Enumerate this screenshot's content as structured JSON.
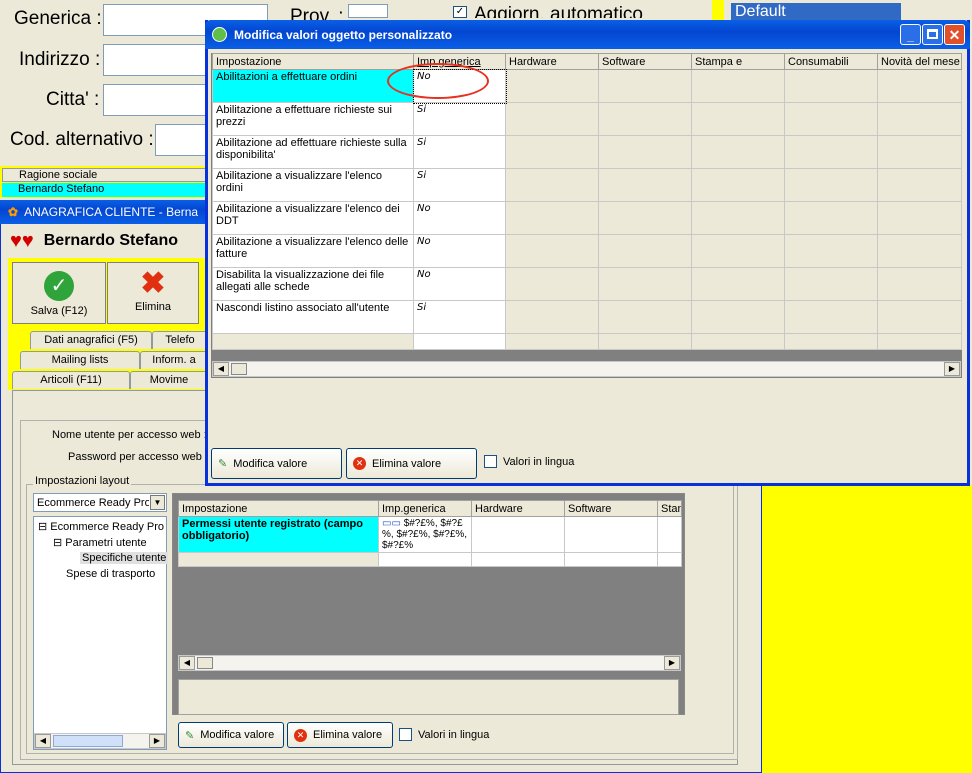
{
  "bg_form": {
    "generica_label": "Generica :",
    "indirizzo_label": "Indirizzo :",
    "citta_label": "Citta' :",
    "cod_label": "Cod. alternativo :",
    "prov_label": "Prov. :",
    "aggiorn_label": "Aggiorn. automatico",
    "default_label": "Default"
  },
  "bg_list": {
    "header": "Ragione sociale",
    "row1": "Bernardo Stefano"
  },
  "cliente": {
    "title": "ANAGRAFICA CLIENTE - Berna",
    "name": "Bernardo Stefano",
    "save_label": "Salva (F12)",
    "delete_label": "Elimina",
    "tabs": {
      "t1": "Dati anagrafici (F5)",
      "t2": "Telefo",
      "t3": "Mailing lists",
      "t4": "Inform. a",
      "t5": "Articoli (F11)",
      "t6": "Movime"
    },
    "web_user_label": "Nome utente per accesso web :",
    "web_pass_label": "Password per accesso web :",
    "layout_group": "Impostazioni layout",
    "layout_select": "Ecommerce Ready Pro",
    "tree": {
      "root": "Ecommerce Ready Pro",
      "child": "Parametri utente",
      "leaf": "Specifiche utente",
      "other": "Spese di trasporto"
    },
    "grid": {
      "headers": [
        "Impostazione",
        "Imp.generica",
        "Hardware",
        "Software",
        "Stan"
      ],
      "row_label": "Permessi utente registrato (campo obbligatorio)",
      "row_value": "$#?£%, $#?£%, $#?£%, $#?£%, $#?£%"
    },
    "modify_label": "Modifica valore",
    "delete_value_label": "Elimina valore",
    "lingua_label": "Valori in lingua"
  },
  "dialog": {
    "title": "Modifica valori oggetto personalizzato",
    "headers": [
      "Impostazione",
      "Imp.generica",
      "Hardware",
      "Software",
      "Stampa e",
      "Consumabili",
      "Novità del mese"
    ],
    "rows": [
      {
        "label": "Abilitazioni a effettuare ordini",
        "value": "No"
      },
      {
        "label": "Abilitazione a effettuare richieste sui prezzi",
        "value": "Si"
      },
      {
        "label": "Abilitazione ad effettuare richieste sulla disponibilita'",
        "value": "Si"
      },
      {
        "label": "Abilitazione a visualizzare l'elenco ordini",
        "value": "Si"
      },
      {
        "label": "Abilitazione a visualizzare l'elenco dei DDT",
        "value": "No"
      },
      {
        "label": "Abilitazione a visualizzare l'elenco delle fatture",
        "value": "No"
      },
      {
        "label": "Disabilita la visualizzazione dei file allegati alle schede",
        "value": "No"
      },
      {
        "label": "Nascondi listino associato all'utente",
        "value": "Si"
      }
    ],
    "modify_label": "Modifica valore",
    "delete_label": "Elimina valore",
    "lingua_label": "Valori in lingua"
  },
  "colors": {
    "selected_cell": "#00ffff",
    "accent_yellow": "#ffff00",
    "xp_blue": "#0a5fe6",
    "highlight_red": "#e63020"
  }
}
